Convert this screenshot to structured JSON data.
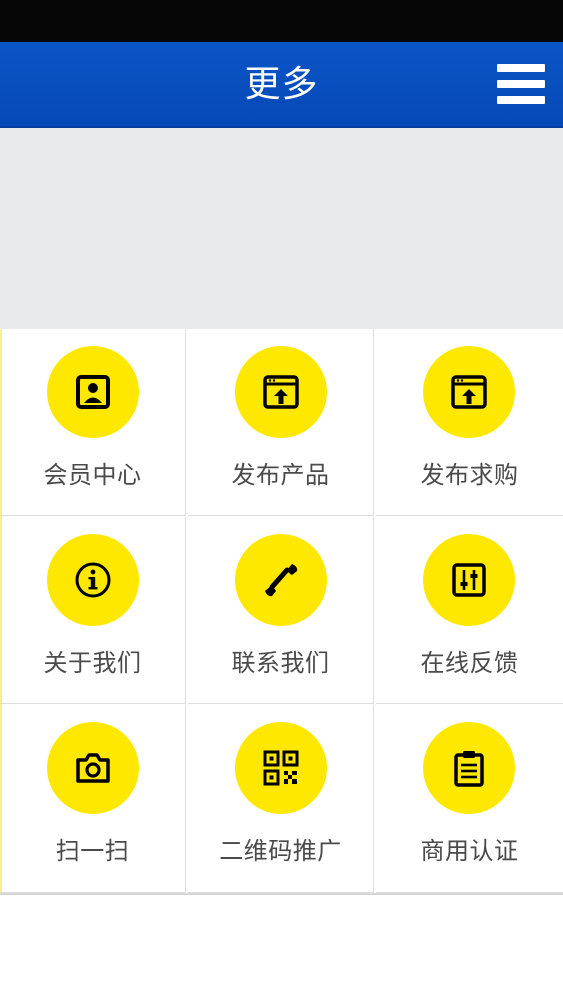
{
  "header": {
    "title": "更多",
    "menu_icon": "hamburger-menu-icon"
  },
  "colors": {
    "header_bg": "#0a55c6",
    "icon_circle": "#ffe800",
    "label_text": "#4a4a4a",
    "banner_bg": "#e8eaeb"
  },
  "grid": {
    "items": [
      {
        "label": "会员中心",
        "icon": "member-card-icon"
      },
      {
        "label": "发布产品",
        "icon": "upload-window-icon"
      },
      {
        "label": "发布求购",
        "icon": "upload-window-icon"
      },
      {
        "label": "关于我们",
        "icon": "info-circle-icon"
      },
      {
        "label": "联系我们",
        "icon": "phone-icon"
      },
      {
        "label": "在线反馈",
        "icon": "sliders-icon"
      },
      {
        "label": "扫一扫",
        "icon": "camera-icon"
      },
      {
        "label": "二维码推广",
        "icon": "qr-code-icon"
      },
      {
        "label": "商用认证",
        "icon": "clipboard-icon"
      }
    ]
  }
}
